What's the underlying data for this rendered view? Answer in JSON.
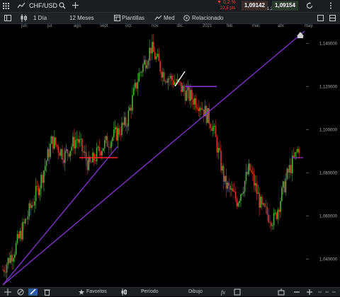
{
  "header": {
    "instrument": "CHF/USD",
    "change_pct": "▼ 0,2 %",
    "change_pts": "22,5 pts",
    "bid": "1,09142",
    "spread": "1,2",
    "ask": "1,09154"
  },
  "toolbar": {
    "interval": "1 Día",
    "range": "12 Meses",
    "templates": "Plantillas",
    "indicator": "Med",
    "related": "Relacionado"
  },
  "months": [
    "jun.",
    "jul.",
    "ago.",
    "sept.",
    "oct.",
    "nov.",
    "dic.",
    "2021",
    "feb.",
    "mar.",
    "abr.",
    "may."
  ],
  "y_axis": [
    "1,140000",
    "1,120000",
    "1,100000",
    "1,080000",
    "1,060000",
    "1,040000"
  ],
  "bottombar": {
    "favorites": "Favoritos",
    "period": "Período",
    "drawing": "Dibujo"
  },
  "colors": {
    "up": "#4caf3a",
    "down": "#d23a2a",
    "trendline": "#8b32d6",
    "support": "#e8232a",
    "panel": "#1c1f22"
  },
  "chart_data": {
    "type": "candlestick",
    "title": "",
    "xlabel": "",
    "ylabel": "",
    "ylim": [
      1.027,
      1.146
    ],
    "x": [
      "jun.",
      "jul.",
      "ago.",
      "sept.",
      "oct.",
      "nov.",
      "dic.",
      "2021",
      "feb.",
      "mar.",
      "abr.",
      "may."
    ],
    "close": [
      1.035,
      1.045,
      1.06,
      1.075,
      1.095,
      1.088,
      1.096,
      1.083,
      1.092,
      1.097,
      1.103,
      1.125,
      1.138,
      1.126,
      1.122,
      1.116,
      1.112,
      1.102,
      1.075,
      1.067,
      1.082,
      1.063,
      1.058,
      1.078,
      1.092
    ],
    "horizontal_lines": [
      {
        "color": "red",
        "y": 1.087
      },
      {
        "color": "purple",
        "y": 1.12
      },
      {
        "color": "purple",
        "y": 1.087
      }
    ]
  }
}
